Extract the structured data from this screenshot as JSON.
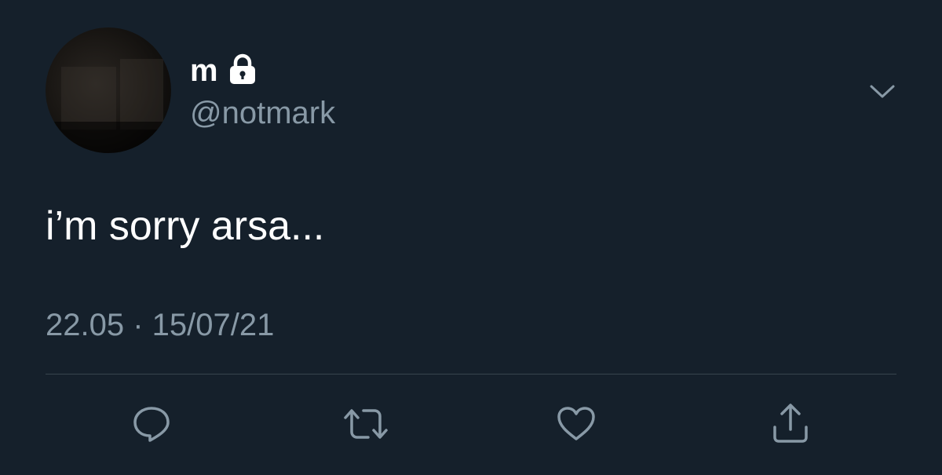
{
  "user": {
    "display_name": "m",
    "handle": "@notmark",
    "protected": true
  },
  "tweet": {
    "text": "i’m sorry arsa...",
    "timestamp": "22.05 · 15/07/21"
  },
  "actions": [
    {
      "name": "reply",
      "icon": "comment-icon"
    },
    {
      "name": "retweet",
      "icon": "retweet-icon"
    },
    {
      "name": "like",
      "icon": "heart-icon"
    },
    {
      "name": "share",
      "icon": "share-icon"
    }
  ],
  "colors": {
    "background": "#15202b",
    "primary_text": "#ffffff",
    "secondary_text": "#8899a6",
    "divider": "#38444d"
  }
}
